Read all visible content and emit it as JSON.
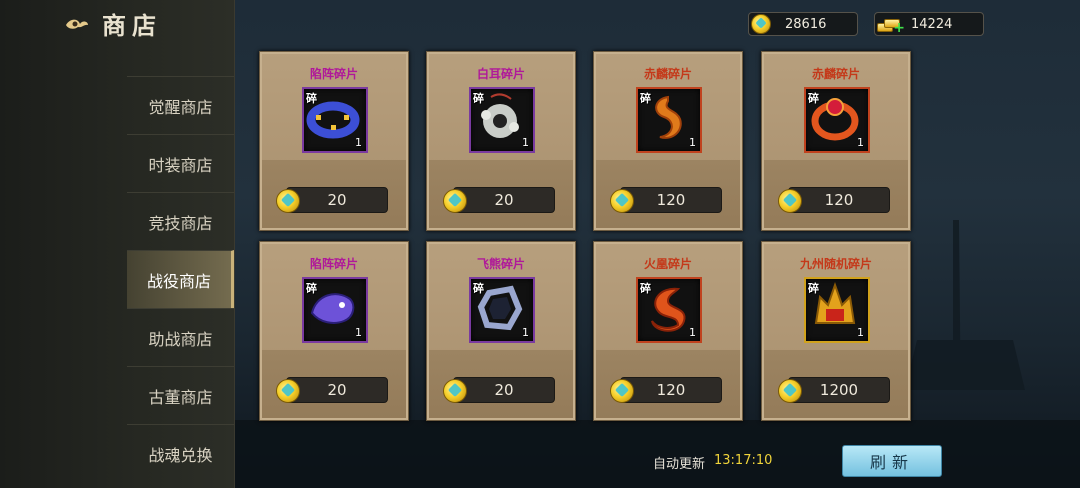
{
  "header": {
    "title": "商店",
    "icon": "cloud-emblem-icon"
  },
  "sidebar": {
    "items": [
      {
        "label": "觉醒商店",
        "active": false
      },
      {
        "label": "时装商店",
        "active": false
      },
      {
        "label": "竞技商店",
        "active": false
      },
      {
        "label": "战役商店",
        "active": true
      },
      {
        "label": "助战商店",
        "active": false
      },
      {
        "label": "古董商店",
        "active": false
      },
      {
        "label": "战魂兑换",
        "active": false
      }
    ]
  },
  "currency": {
    "coin": {
      "value": "28616",
      "icon": "jade-coin-icon"
    },
    "gold": {
      "value": "14224",
      "icon": "gold-ingot-plus-icon"
    }
  },
  "shop": {
    "items": [
      {
        "name": "陷阵碎片",
        "tag": "碎",
        "qty": "1",
        "price": "20",
        "icon": "blue-ring-icon",
        "name_color": "#b0189a"
      },
      {
        "name": "白耳碎片",
        "tag": "碎",
        "qty": "1",
        "price": "20",
        "icon": "silver-charm-icon",
        "name_color": "#b0189a"
      },
      {
        "name": "赤麟碎片",
        "tag": "碎",
        "qty": "1",
        "price": "120",
        "icon": "orange-dragon-icon",
        "name_color": "#c4391a"
      },
      {
        "name": "赤麟碎片",
        "tag": "碎",
        "qty": "1",
        "price": "120",
        "icon": "ruby-ring-icon",
        "name_color": "#c4391a"
      },
      {
        "name": "陷阵碎片",
        "tag": "碎",
        "qty": "1",
        "price": "20",
        "icon": "purple-beast-icon",
        "name_color": "#b0189a"
      },
      {
        "name": "飞熊碎片",
        "tag": "碎",
        "qty": "1",
        "price": "20",
        "icon": "steel-ring-icon",
        "name_color": "#b0189a"
      },
      {
        "name": "火凰碎片",
        "tag": "碎",
        "qty": "1",
        "price": "120",
        "icon": "fire-phoenix-icon",
        "name_color": "#c4391a"
      },
      {
        "name": "九州随机碎片",
        "tag": "碎",
        "qty": "1",
        "price": "1200",
        "icon": "golden-helmet-icon",
        "name_color": "#c4391a"
      }
    ]
  },
  "footer": {
    "auto_refresh_label": "自动更新",
    "time": "13:17:10",
    "refresh_button": "刷新"
  }
}
